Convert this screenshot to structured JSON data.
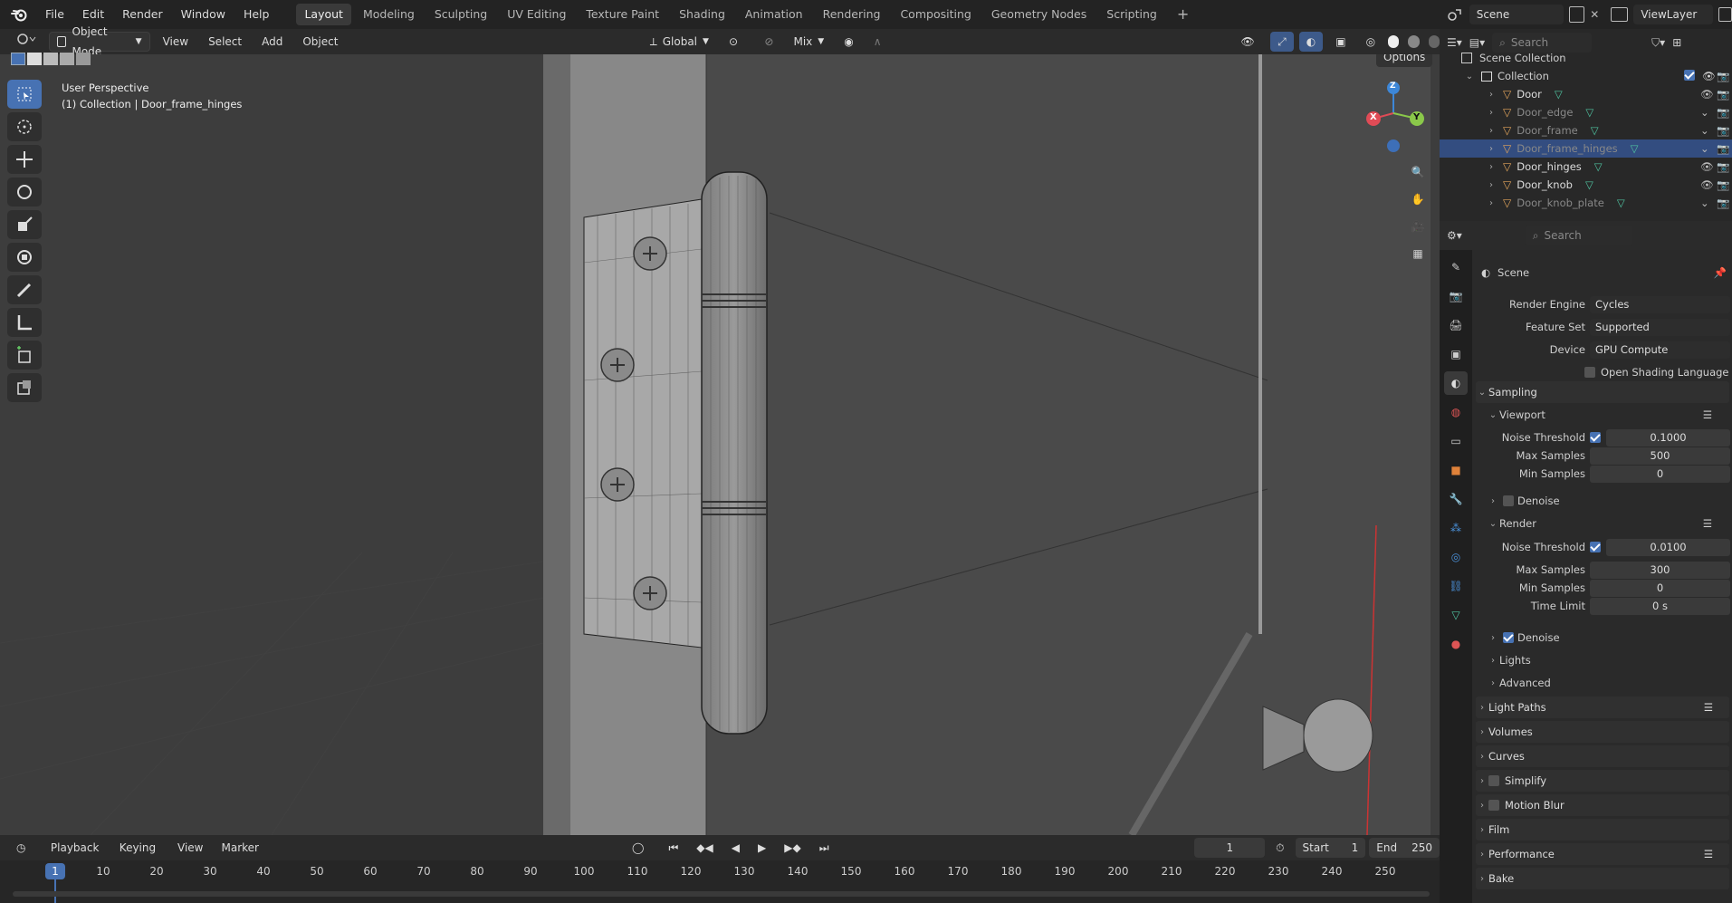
{
  "menu": {
    "items": [
      "File",
      "Edit",
      "Render",
      "Window",
      "Help"
    ]
  },
  "workspaces": {
    "tabs": [
      "Layout",
      "Modeling",
      "Sculpting",
      "UV Editing",
      "Texture Paint",
      "Shading",
      "Animation",
      "Rendering",
      "Compositing",
      "Geometry Nodes",
      "Scripting"
    ],
    "active": "Layout"
  },
  "scene_selector": {
    "scene": "Scene",
    "view_layer": "ViewLayer"
  },
  "viewport_header": {
    "mode": "Object Mode",
    "menus": [
      "View",
      "Select",
      "Add",
      "Object"
    ],
    "transform_orientation": "Global",
    "proportional": "Mix",
    "options": "Options"
  },
  "viewport": {
    "perspective": "User Perspective",
    "context": "(1) Collection | Door_frame_hinges"
  },
  "gizmo": {
    "x": "X",
    "y": "Y",
    "z": "Z"
  },
  "outliner": {
    "search_placeholder": "Search",
    "root": "Scene Collection",
    "collection": "Collection",
    "objects": [
      {
        "name": "Door",
        "visible": true,
        "selected": false
      },
      {
        "name": "Door_edge",
        "visible": false,
        "selected": false
      },
      {
        "name": "Door_frame",
        "visible": false,
        "selected": false
      },
      {
        "name": "Door_frame_hinges",
        "visible": false,
        "selected": true
      },
      {
        "name": "Door_hinges",
        "visible": true,
        "selected": false
      },
      {
        "name": "Door_knob",
        "visible": true,
        "selected": false
      },
      {
        "name": "Door_knob_plate",
        "visible": false,
        "selected": false
      }
    ]
  },
  "properties": {
    "search_placeholder": "Search",
    "context": "Scene",
    "render_engine_label": "Render Engine",
    "render_engine": "Cycles",
    "feature_set_label": "Feature Set",
    "feature_set": "Supported",
    "device_label": "Device",
    "device": "GPU Compute",
    "osl_label": "Open Shading Language",
    "sampling": "Sampling",
    "viewport_label": "Viewport",
    "viewport_noise_label": "Noise Threshold",
    "viewport_noise": "0.1000",
    "viewport_max_label": "Max Samples",
    "viewport_max": "500",
    "viewport_min_label": "Min Samples",
    "viewport_min": "0",
    "viewport_denoise": "Denoise",
    "render_label": "Render",
    "render_noise_label": "Noise Threshold",
    "render_noise": "0.0100",
    "render_max_label": "Max Samples",
    "render_max": "300",
    "render_min_label": "Min Samples",
    "render_min": "0",
    "time_limit_label": "Time Limit",
    "time_limit": "0 s",
    "render_denoise": "Denoise",
    "lights": "Lights",
    "advanced": "Advanced",
    "sections": [
      "Light Paths",
      "Volumes",
      "Curves",
      "Simplify",
      "Motion Blur",
      "Film",
      "Performance",
      "Bake"
    ]
  },
  "timeline": {
    "menus": [
      "Playback",
      "Keying",
      "View",
      "Marker"
    ],
    "current_frame": "1",
    "start_label": "Start",
    "start": "1",
    "end_label": "End",
    "end": "250",
    "ticks": [
      "1",
      "10",
      "20",
      "30",
      "40",
      "50",
      "60",
      "70",
      "80",
      "90",
      "100",
      "110",
      "120",
      "130",
      "140",
      "150",
      "160",
      "170",
      "180",
      "190",
      "200",
      "210",
      "220",
      "230",
      "240",
      "250"
    ]
  },
  "colors": {
    "accent": "#4772b3",
    "selected_row": "#334d80",
    "mesh_icon": "#e0a35a",
    "vertex_group": "#4fc3a1",
    "axis_x": "#e04b56",
    "axis_y": "#8ac84a",
    "axis_z": "#3d87d8"
  }
}
